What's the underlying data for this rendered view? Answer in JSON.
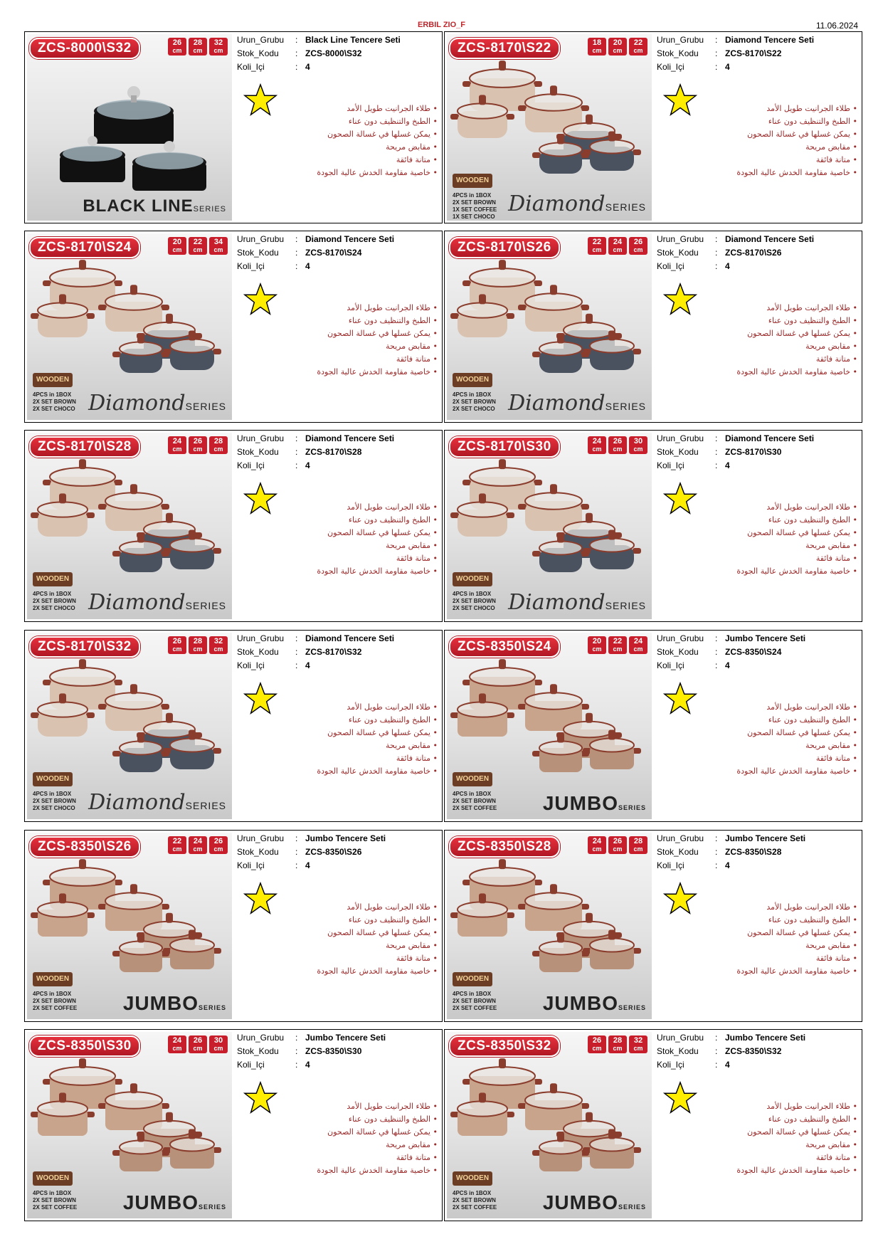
{
  "header": {
    "title": "ERBIL ZIO_F",
    "date": "11.06.2024"
  },
  "labels": {
    "group": "Urun_Grubu",
    "code": "Stok_Kodu",
    "qty": "Koli_Içi",
    "colon": ":"
  },
  "features": [
    "طلاء الجرانيت طويل الأمد",
    "الطبخ والتنظيف دون عناء",
    "يمكن غسلها في غسالة الصحون",
    "مقابض مريحة",
    "متانة فائقة",
    "خاصية مقاومة الخدش عالية الجودة"
  ],
  "cards": [
    {
      "badge": "ZCS-8000\\S32",
      "sizes": [
        "26",
        "28",
        "32"
      ],
      "unit": "cm",
      "group": "Black Line Tencere Seti",
      "code": "ZCS-8000\\S32",
      "qty": "4",
      "series_main": "BLACK LINE",
      "series_sub": "SERIES",
      "box": [],
      "wooden": ""
    },
    {
      "badge": "ZCS-8170\\S22",
      "sizes": [
        "18",
        "20",
        "22"
      ],
      "unit": "cm",
      "group": "Diamond Tencere Seti",
      "code": "ZCS-8170\\S22",
      "qty": "4",
      "series_main": "Diamond",
      "series_sub": "SERIES",
      "box": [
        "4PCS in 1BOX",
        "2X SET BROWN",
        "1X SET COFFEE",
        "1X SET CHOCO"
      ],
      "wooden": "WOODEN"
    },
    {
      "badge": "ZCS-8170\\S24",
      "sizes": [
        "20",
        "22",
        "34"
      ],
      "unit": "cm",
      "group": "Diamond Tencere Seti",
      "code": "ZCS-8170\\S24",
      "qty": "4",
      "series_main": "Diamond",
      "series_sub": "SERIES",
      "box": [
        "4PCS in 1BOX",
        "2X SET BROWN",
        "2X SET CHOCO"
      ],
      "wooden": "WOODEN"
    },
    {
      "badge": "ZCS-8170\\S26",
      "sizes": [
        "22",
        "24",
        "26"
      ],
      "unit": "cm",
      "group": "Diamond Tencere Seti",
      "code": "ZCS-8170\\S26",
      "qty": "4",
      "series_main": "Diamond",
      "series_sub": "SERIES",
      "box": [
        "4PCS in 1BOX",
        "2X SET BROWN",
        "2X SET CHOCO"
      ],
      "wooden": "WOODEN"
    },
    {
      "badge": "ZCS-8170\\S28",
      "sizes": [
        "24",
        "26",
        "28"
      ],
      "unit": "cm",
      "group": "Diamond Tencere Seti",
      "code": "ZCS-8170\\S28",
      "qty": "4",
      "series_main": "Diamond",
      "series_sub": "SERIES",
      "box": [
        "4PCS in 1BOX",
        "2X SET BROWN",
        "2X SET CHOCO"
      ],
      "wooden": "WOODEN"
    },
    {
      "badge": "ZCS-8170\\S30",
      "sizes": [
        "24",
        "26",
        "30"
      ],
      "unit": "cm",
      "group": "Diamond Tencere Seti",
      "code": "ZCS-8170\\S30",
      "qty": "4",
      "series_main": "Diamond",
      "series_sub": "SERIES",
      "box": [
        "4PCS in 1BOX",
        "2X SET BROWN",
        "2X SET CHOCO"
      ],
      "wooden": "WOODEN"
    },
    {
      "badge": "ZCS-8170\\S32",
      "sizes": [
        "26",
        "28",
        "32"
      ],
      "unit": "cm",
      "group": "Diamond Tencere Seti",
      "code": "ZCS-8170\\S32",
      "qty": "4",
      "series_main": "Diamond",
      "series_sub": "SERIES",
      "box": [
        "4PCS in 1BOX",
        "2X SET BROWN",
        "2X SET CHOCO"
      ],
      "wooden": "WOODEN"
    },
    {
      "badge": "ZCS-8350\\S24",
      "sizes": [
        "20",
        "22",
        "24"
      ],
      "unit": "cm",
      "group": "Jumbo Tencere Seti",
      "code": "ZCS-8350\\S24",
      "qty": "4",
      "series_main": "JUMBO",
      "series_sub": "SERIES",
      "box": [
        "4PCS in 1BOX",
        "2X SET BROWN",
        "2X SET COFFEE"
      ],
      "wooden": "WOODEN"
    },
    {
      "badge": "ZCS-8350\\S26",
      "sizes": [
        "22",
        "24",
        "26"
      ],
      "unit": "cm",
      "group": "Jumbo Tencere Seti",
      "code": "ZCS-8350\\S26",
      "qty": "4",
      "series_main": "JUMBO",
      "series_sub": "SERIES",
      "box": [
        "4PCS in 1BOX",
        "2X SET BROWN",
        "2X SET COFFEE"
      ],
      "wooden": "WOODEN"
    },
    {
      "badge": "ZCS-8350\\S28",
      "sizes": [
        "24",
        "26",
        "28"
      ],
      "unit": "cm",
      "group": "Jumbo Tencere Seti",
      "code": "ZCS-8350\\S28",
      "qty": "4",
      "series_main": "JUMBO",
      "series_sub": "SERIES",
      "box": [
        "4PCS in 1BOX",
        "2X SET BROWN",
        "2X SET COFFEE"
      ],
      "wooden": "WOODEN"
    },
    {
      "badge": "ZCS-8350\\S30",
      "sizes": [
        "24",
        "26",
        "30"
      ],
      "unit": "cm",
      "group": "Jumbo Tencere Seti",
      "code": "ZCS-8350\\S30",
      "qty": "4",
      "series_main": "JUMBO",
      "series_sub": "SERIES",
      "box": [
        "4PCS in 1BOX",
        "2X SET BROWN",
        "2X SET COFFEE"
      ],
      "wooden": "WOODEN"
    },
    {
      "badge": "ZCS-8350\\S32",
      "sizes": [
        "26",
        "28",
        "32"
      ],
      "unit": "cm",
      "group": "Jumbo Tencere Seti",
      "code": "ZCS-8350\\S32",
      "qty": "4",
      "series_main": "JUMBO",
      "series_sub": "SERIES",
      "box": [
        "4PCS in 1BOX",
        "2X SET BROWN",
        "2X SET COFFEE"
      ],
      "wooden": "WOODEN"
    }
  ],
  "colors": {
    "accent": "#c0272d",
    "feature_text": "#9b2a2a",
    "star": "#ffee00"
  },
  "icons": {
    "rating": "star-icon"
  }
}
